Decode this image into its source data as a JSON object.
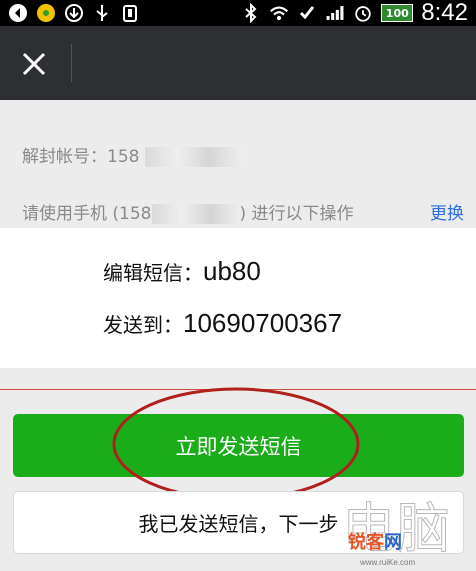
{
  "status_bar": {
    "time": "8:42",
    "battery": "100"
  },
  "account": {
    "label": "解封帐号：",
    "number_visible": "158"
  },
  "instruction": {
    "prefix": "请使用手机 (",
    "number_visible": "158",
    "suffix": ") 进行以下操作",
    "switch_label": "更换"
  },
  "sms": {
    "edit_label": "编辑短信：",
    "content": "ub80",
    "send_to_label": "发送到：",
    "number": "10690700367"
  },
  "buttons": {
    "send_sms": "立即发送短信",
    "next_step": "我已发送短信，下一步"
  },
  "watermark": {
    "text_part1": "锐客",
    "text_part2": "网",
    "url": "www.ruiKe.com"
  },
  "colors": {
    "topbar": "#2e2f33",
    "primary_green": "#1aad19",
    "link_blue": "#2b6fe0",
    "annotation_red": "#b0201c"
  }
}
